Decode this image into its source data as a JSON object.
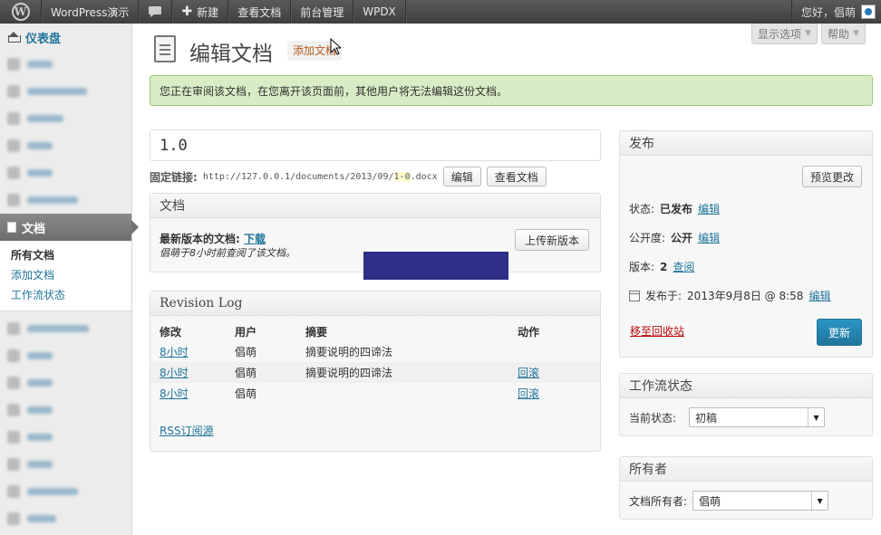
{
  "adminbar": {
    "site_name": "WordPress演示",
    "new_label": "新建",
    "view_doc": "查看文档",
    "frontend": "前台管理",
    "wpdx": "WPDX",
    "greeting": "您好，倡萌"
  },
  "screen_options": {
    "options": "显示选项",
    "help": "帮助"
  },
  "sidebar": {
    "dashboard": "仪表盘",
    "documents": "文档",
    "submenu": [
      "所有文档",
      "添加文档",
      "工作流状态"
    ]
  },
  "page": {
    "title": "编辑文档",
    "add_new": "添加文档",
    "notice": "您正在审阅该文档，在您离开该页面前，其他用户将无法编辑这份文档。",
    "doc_title": "1.0",
    "permalink_label": "固定链接:",
    "permalink_pre": "http://127.0.0.1/documents/2013/09/",
    "permalink_slug": "1-0",
    "permalink_ext": ".docx",
    "edit_btn": "编辑",
    "view_btn": "查看文档"
  },
  "docbox": {
    "title": "文档",
    "latest_label": "最新版本的文档:",
    "download": "下载",
    "last_viewed": "倡萌于8小时前查阅了该文档。",
    "upload": "上传新版本"
  },
  "revlog": {
    "title": "Revision Log",
    "headers": [
      "修改",
      "用户",
      "摘要",
      "动作"
    ],
    "rows": [
      {
        "time": "8小时",
        "user": "倡萌",
        "summary": "摘要说明的四谛法",
        "action": ""
      },
      {
        "time": "8小时",
        "user": "倡萌",
        "summary": "摘要说明的四谛法",
        "action": "回滚"
      },
      {
        "time": "8小时",
        "user": "倡萌",
        "summary": "",
        "action": "回滚"
      }
    ],
    "rss": "RSS订阅源"
  },
  "publish": {
    "title": "发布",
    "preview": "预览更改",
    "status_label": "状态:",
    "status_value": "已发布",
    "visibility_label": "公开度:",
    "visibility_value": "公开",
    "revisions_label": "版本:",
    "revisions_value": "2",
    "browse": "查阅",
    "published_label": "发布于:",
    "published_value": "2013年9月8日 @ 8:58",
    "edit": "编辑",
    "trash": "移至回收站",
    "update": "更新"
  },
  "workflow": {
    "title": "工作流状态",
    "label": "当前状态:",
    "value": "初稿"
  },
  "owner": {
    "title": "所有者",
    "label": "文档所有者:",
    "value": "倡萌"
  },
  "colors": {
    "accent": "#21759b",
    "notice_bg": "#d8ecc5",
    "trash": "#bc0b0b",
    "redaction": "#2e2f86"
  }
}
